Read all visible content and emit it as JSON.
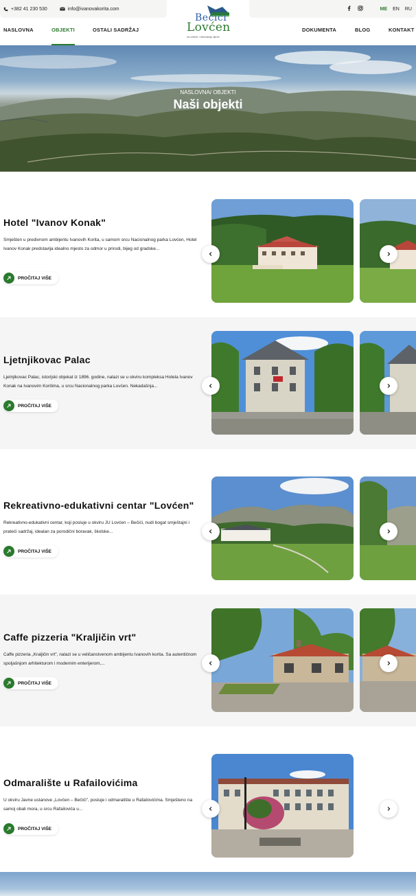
{
  "topbar": {
    "phone": "+382 41 230 530",
    "email": "info@ivanovakorita.com",
    "social": [
      "facebook-icon",
      "instagram-icon"
    ],
    "languages": [
      {
        "code": "ME",
        "active": true
      },
      {
        "code": "EN",
        "active": false
      },
      {
        "code": "RU",
        "active": false
      }
    ]
  },
  "logo": {
    "line1": "Bečići",
    "line2": "Lovćen",
    "tagline": "za odmor i rekreaciju djece"
  },
  "nav": {
    "left": [
      {
        "label": "NASLOVNA",
        "active": false
      },
      {
        "label": "OBJEKTI",
        "active": true
      },
      {
        "label": "OSTALI SADRŽAJ",
        "active": false
      }
    ],
    "right": [
      {
        "label": "DOKUMENTA",
        "active": false
      },
      {
        "label": "BLOG",
        "active": false
      },
      {
        "label": "KONTAKT",
        "active": false
      }
    ]
  },
  "hero": {
    "breadcrumb": "NASLOVNA/ OBJEKTI",
    "title": "Naši objekti"
  },
  "objects": [
    {
      "title": "Hotel \"Ivanov Konak\"",
      "description": "Smješten u predivnom ambijentu Ivanovih Korita, u samom srcu Nacionalnog parka Lovćen, Hotel Ivanov Konak predstavlja idealno mjesto za odmor u prirodi, bijeg od gradske...",
      "button": "PROČITAJ VIŠE"
    },
    {
      "title": "Ljetnjikovac Palac",
      "description": "Ljetnjikovac Palac, istorijski objekat iz 1896. godine, nalazi se u okviru kompleksa Hotela Ivanov Konak na Ivanovim Koritima, u srcu Nacionalnog parka Lovćen. Nekadašnja...",
      "button": "PROČITAJ VIŠE"
    },
    {
      "title": "Rekreativno-edukativni centar \"Lovćen\"",
      "description": "Rekreativno-edukativni centar, koji posluje u okviru JU Lovćen – Bečići, nudi bogat smještajni i prateći sadržaj, idealan za porodični boravak, školske...",
      "button": "PROČITAJ VIŠE"
    },
    {
      "title": "Caffe pizzeria \"Kraljičin vrt\"",
      "description": "Caffe pizzeria „Kraljičin vrt\", nalazi se u veličanstvenom ambijentu Ivanovih korita. Sa autentičnom spoljašnjom arhitekturom i modernim enterijerom,...",
      "button": "PROČITAJ VIŠE"
    },
    {
      "title": "Odmaralište u Rafailovićima",
      "description": "U okviru Javne ustanove „Lovćen – Bečići\", posluje i odmaralište u Rafailovićima. Smješteno na samoj obali mora, u srcu Rafailovića u...",
      "button": "PROČITAJ VIŠE"
    }
  ],
  "colors": {
    "accent_green": "#2a7a2d",
    "logo_blue": "#2b5ea8",
    "section_gray": "#f5f5f5"
  }
}
